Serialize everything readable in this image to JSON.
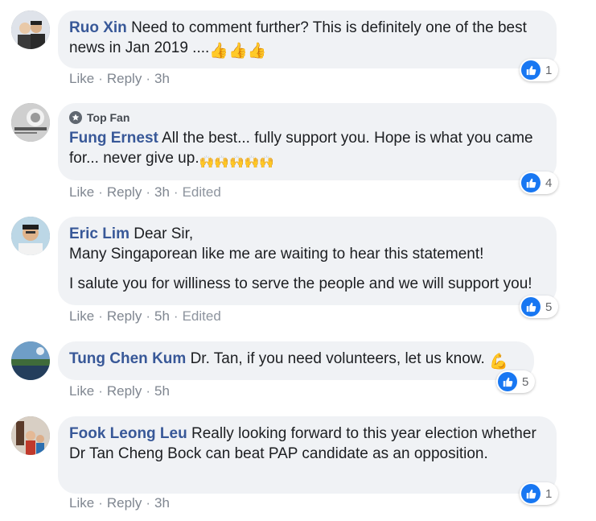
{
  "comments": [
    {
      "author": "Ruo Xin",
      "badge": "",
      "text": "Need to comment further? This is definitely one of the best news in Jan 2019 ....",
      "emoji": "👍👍👍",
      "actions": {
        "like": "Like",
        "reply": "Reply",
        "time": "3h",
        "edited": ""
      },
      "reactions": {
        "icon": "like-icon",
        "count": "1"
      }
    },
    {
      "author": "Fung Ernest",
      "badge": "Top Fan",
      "text": "All the best... fully support you. Hope is what you came for... never give up.",
      "emoji": "🙌🙌🙌🙌🙌",
      "actions": {
        "like": "Like",
        "reply": "Reply",
        "time": "3h",
        "edited": "Edited"
      },
      "reactions": {
        "icon": "like-icon",
        "count": "4"
      }
    },
    {
      "author": "Eric Lim",
      "badge": "",
      "text": "Dear Sir,\nMany Singaporean like me are waiting to hear this statement!",
      "text2": "I salute you for williness to serve the people and we will support you!",
      "actions": {
        "like": "Like",
        "reply": "Reply",
        "time": "5h",
        "edited": "Edited"
      },
      "reactions": {
        "icon": "like-icon",
        "count": "5"
      }
    },
    {
      "author": "Tung Chen Kum",
      "badge": "",
      "text": "Dr. Tan, if you need volunteers, let us know.",
      "emoji": "💪",
      "actions": {
        "like": "Like",
        "reply": "Reply",
        "time": "5h",
        "edited": ""
      },
      "reactions": {
        "icon": "like-icon",
        "count": "5"
      }
    },
    {
      "author": "Fook Leong Leu",
      "badge": "",
      "text": "Really looking forward to this year election whether Dr Tan Cheng Bock can beat PAP candidate as an opposition.",
      "actions": {
        "like": "Like",
        "reply": "Reply",
        "time": "3h",
        "edited": ""
      },
      "reactions": {
        "icon": "like-icon",
        "count": "1"
      }
    }
  ],
  "colors": {
    "name": "#385898",
    "bubble": "#f0f2f5",
    "like": "#1877f2",
    "meta": "#8d949e"
  }
}
